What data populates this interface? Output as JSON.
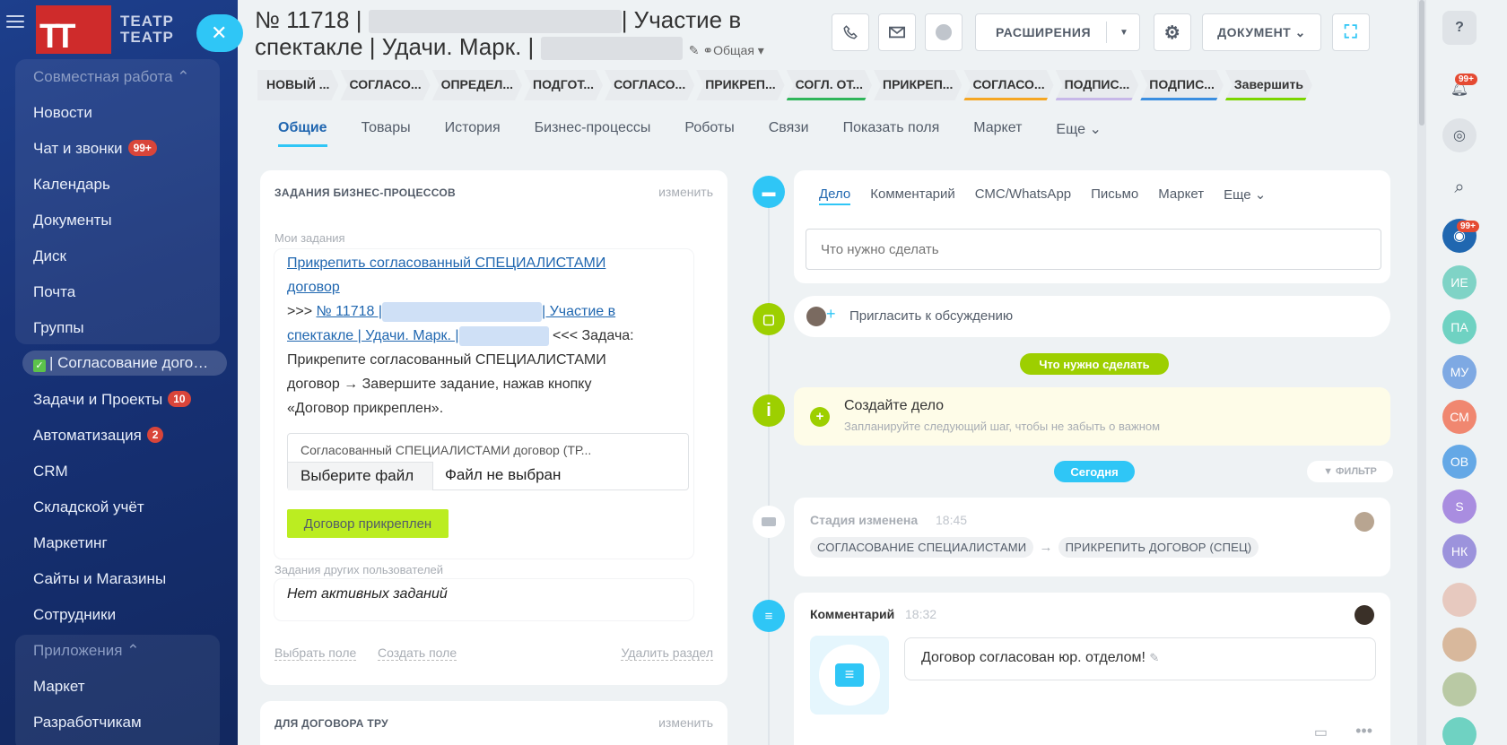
{
  "sidebar": {
    "logo_text_1": "ТЕАТР",
    "logo_text_2": "ТЕАТР",
    "collab_header": "Совместная работа",
    "items": [
      "Новости",
      "Чат и звонки",
      "Календарь",
      "Документы",
      "Диск",
      "Почта",
      "Группы"
    ],
    "chat_badge": "99+",
    "active_item": "| Согласование дого…",
    "items2": [
      "Задачи и Проекты",
      "Автоматизация",
      "CRM",
      "Складской учёт",
      "Маркетинг",
      "Сайты и Магазины",
      "Сотрудники"
    ],
    "tasks_badge": "10",
    "auto_badge": "2",
    "apps_header": "Приложения",
    "items3": [
      "Маркет",
      "Разработчикам"
    ]
  },
  "header": {
    "title_prefix": "№ 11718 |",
    "title_mid": "| Участие в",
    "title_line2": "спектакле | Удачи. Марк. |",
    "category": "Общая",
    "extensions_label": "РАСШИРЕНИЯ",
    "document_label": "ДОКУМЕНТ"
  },
  "stages": [
    {
      "label": "НОВЫЙ ...",
      "color": "#e8ebee"
    },
    {
      "label": "СОГЛАСО...",
      "color": "#e8ebee"
    },
    {
      "label": "ОПРЕДЕЛ...",
      "color": "#e8ebee"
    },
    {
      "label": "ПОДГОТ...",
      "color": "#e8ebee"
    },
    {
      "label": "СОГЛАСО...",
      "color": "#e8ebee"
    },
    {
      "label": "ПРИКРЕП...",
      "color": "#e8ebee"
    },
    {
      "label": "СОГЛ. ОТ...",
      "color": "#2fb55a"
    },
    {
      "label": "ПРИКРЕП...",
      "color": "#e8ebee"
    },
    {
      "label": "СОГЛАСО...",
      "color": "#f5a623"
    },
    {
      "label": "ПОДПИС...",
      "color": "#c7b8e8"
    },
    {
      "label": "ПОДПИС...",
      "color": "#3b8ee0"
    },
    {
      "label": "Завершить",
      "color": "#7bd500"
    }
  ],
  "tabs": [
    "Общие",
    "Товары",
    "История",
    "Бизнес-процессы",
    "Роботы",
    "Связи",
    "Показать поля",
    "Маркет",
    "Еще"
  ],
  "bp_card": {
    "title": "ЗАДАНИЯ БИЗНЕС-ПРОЦЕССОВ",
    "edit": "изменить",
    "my_tasks": "Мои задания",
    "task_link_1": "Прикрепить согласованный СПЕЦИАЛИСТАМИ",
    "task_link_2": "договор",
    "arrows_in": ">>>",
    "deal_link_a": "№ 11718 |",
    "deal_link_b": "| Участие в",
    "deal_link_c": "спектакле | Удачи. Марк. |",
    "arrows_out": "<<< Задача:",
    "desc_1": "Прикрепите согласованный СПЕЦИАЛИСТАМИ",
    "desc_2": "договор → Завершите задание, нажав кнопку",
    "desc_3": "«Договор прикреплен».",
    "file_label": "Согласованный СПЕЦИАЛИСТАМИ договор (ТР...",
    "choose_file": "Выберите файл",
    "no_file": "Файл не выбран",
    "attach_btn": "Договор прикреплен",
    "other_tasks": "Задания других пользователей",
    "no_tasks": "Нет активных заданий",
    "choose_field": "Выбрать поле",
    "create_field": "Создать поле",
    "delete_section": "Удалить раздел"
  },
  "card2": {
    "title": "ДЛЯ ДОГОВОРА ТРУ",
    "edit": "изменить"
  },
  "activity": {
    "tabs": [
      "Дело",
      "Комментарий",
      "СМС/WhatsApp",
      "Письмо",
      "Маркет",
      "Еще"
    ],
    "placeholder": "Что нужно сделать",
    "invite": "Пригласить к обсуждению",
    "todo_pill": "Что нужно сделать",
    "create_title": "Создайте дело",
    "create_sub": "Запланируйте следующий шаг, чтобы не забыть о важном",
    "today_pill": "Сегодня",
    "filter": "ФИЛЬТР",
    "stage_changed": "Стадия изменена",
    "stage_time": "18:45",
    "stage_from": "СОГЛАСОВАНИЕ СПЕЦИАЛИСТАМИ",
    "stage_to": "ПРИКРЕПИТЬ ДОГОВОР (СПЕЦ)",
    "comment_title": "Комментарий",
    "comment_time": "18:32",
    "comment_text": "Договор согласован юр. отделом!"
  },
  "rightbar": {
    "badge1": "99+",
    "badge2": "99+",
    "avatars": [
      {
        "initials": "ИЕ",
        "color": "#7fd3c6"
      },
      {
        "initials": "ПА",
        "color": "#6fd2c2"
      },
      {
        "initials": "МУ",
        "color": "#7ea9e3"
      },
      {
        "initials": "СМ",
        "color": "#f08770"
      },
      {
        "initials": "ОВ",
        "color": "#64a8e6"
      },
      {
        "initials": "S",
        "color": "#a98de0"
      },
      {
        "initials": "НК",
        "color": "#9c93dc"
      }
    ]
  }
}
